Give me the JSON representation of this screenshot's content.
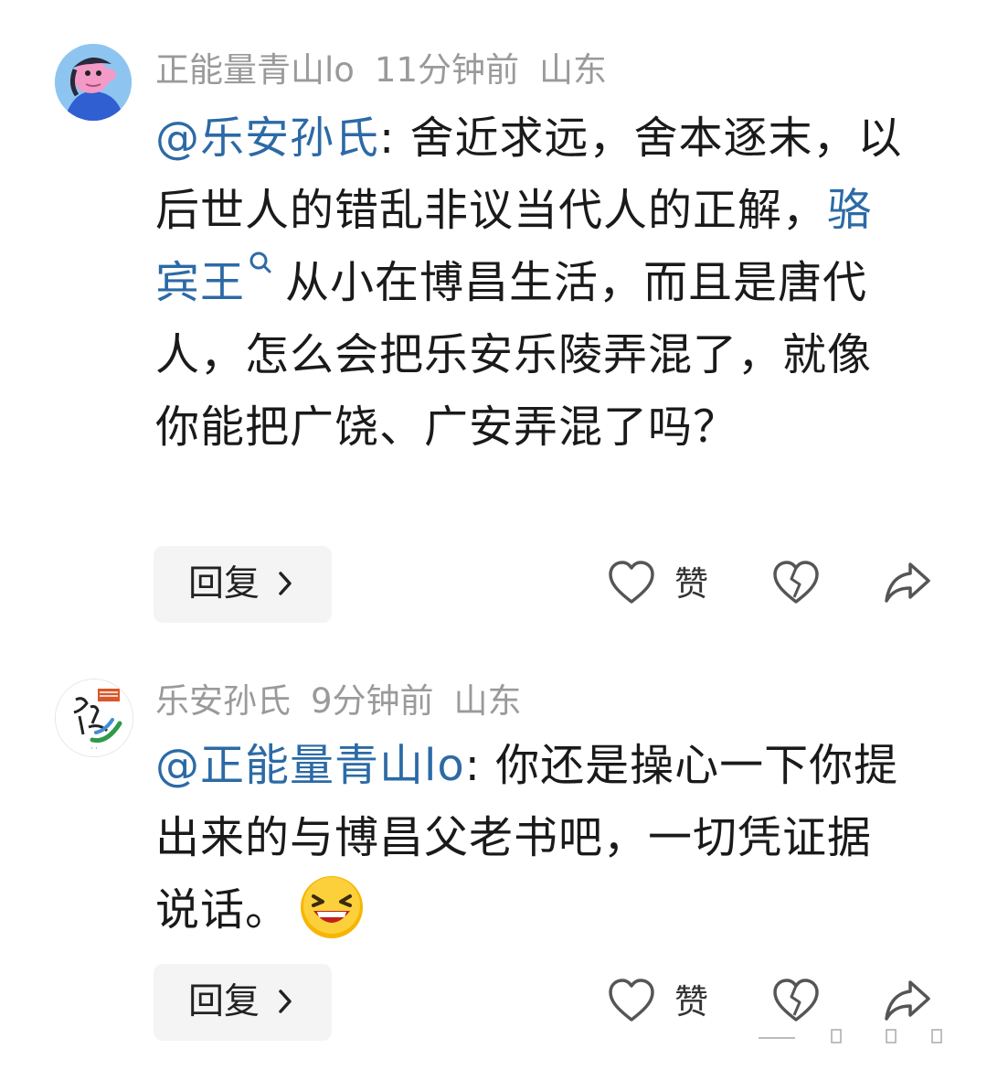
{
  "comments": [
    {
      "username": "正能量青山lo",
      "time": "11分钟前",
      "location": "山东",
      "mention": "@乐安孙氏",
      "text_a": ": 舍近求远，舍本逐末，以后世人的错乱非议当代人的正解，",
      "link": "骆宾王",
      "text_b": "从小在博昌生活，而且是唐代人，怎么会把乐安乐陵弄混了，就像你能把广饶、广安弄混了吗？",
      "reply_label": "回复",
      "like_label": "赞"
    },
    {
      "username": "乐安孙氏",
      "time": "9分钟前",
      "location": "山东",
      "mention": "@正能量青山lo",
      "text_a": ": 你还是操心一下你提出来的与博昌父老书吧，一切凭证据说话。",
      "emoji": "laughing-emoji",
      "reply_label": "回复",
      "like_label": "赞"
    }
  ],
  "colors": {
    "link": "#2c6aa6",
    "meta": "#9a9a9a",
    "reply_bg": "#f4f4f4"
  }
}
